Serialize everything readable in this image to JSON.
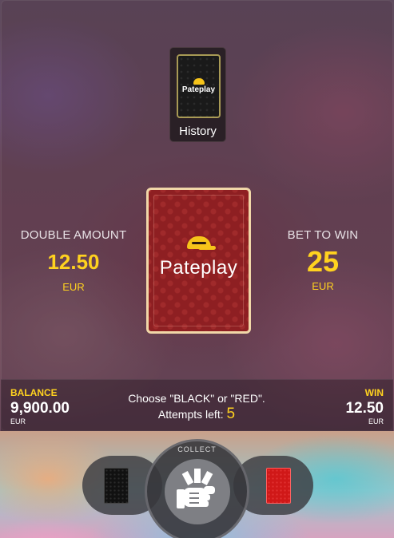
{
  "history": {
    "label": "History",
    "card_brand": "Pateplay"
  },
  "card": {
    "brand": "Pateplay"
  },
  "double_amount": {
    "label": "DOUBLE AMOUNT",
    "value": "12.50",
    "currency": "EUR"
  },
  "bet_to_win": {
    "label": "BET TO WIN",
    "value": "25",
    "currency": "EUR"
  },
  "balance": {
    "label": "BALANCE",
    "value": "9,900.00",
    "currency": "EUR"
  },
  "win": {
    "label": "WIN",
    "value": "12.50",
    "currency": "EUR"
  },
  "message": {
    "line1": "Choose \"BLACK\" or \"RED\".",
    "attempts_label": "Attempts left:",
    "attempts_value": "5"
  },
  "controls": {
    "collect_label": "COLLECT",
    "black_icon": "black-card-icon",
    "red_icon": "red-card-icon",
    "collect_icon": "hand-money-icon"
  },
  "colors": {
    "accent": "#ffd21f",
    "card_red": "#8e1f22",
    "button_red": "#d01818"
  }
}
